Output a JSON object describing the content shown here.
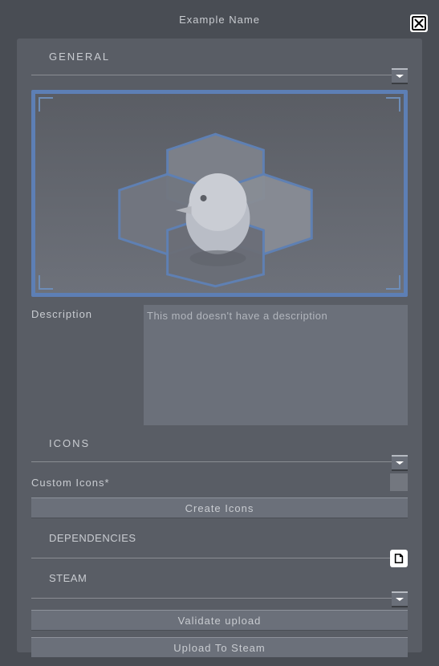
{
  "window": {
    "title": "Example Name"
  },
  "sections": {
    "general": {
      "label": "GENERAL",
      "description_label": "Description",
      "description_value": "This mod doesn't have a description"
    },
    "icons": {
      "label": "ICONS",
      "custom_icons_label": "Custom Icons*",
      "create_button": "Create Icons"
    },
    "dependencies": {
      "label": "DEPENDENCIES"
    },
    "steam": {
      "label": "STEAM",
      "validate_button": "Validate upload",
      "upload_button": "Upload To Steam"
    }
  }
}
